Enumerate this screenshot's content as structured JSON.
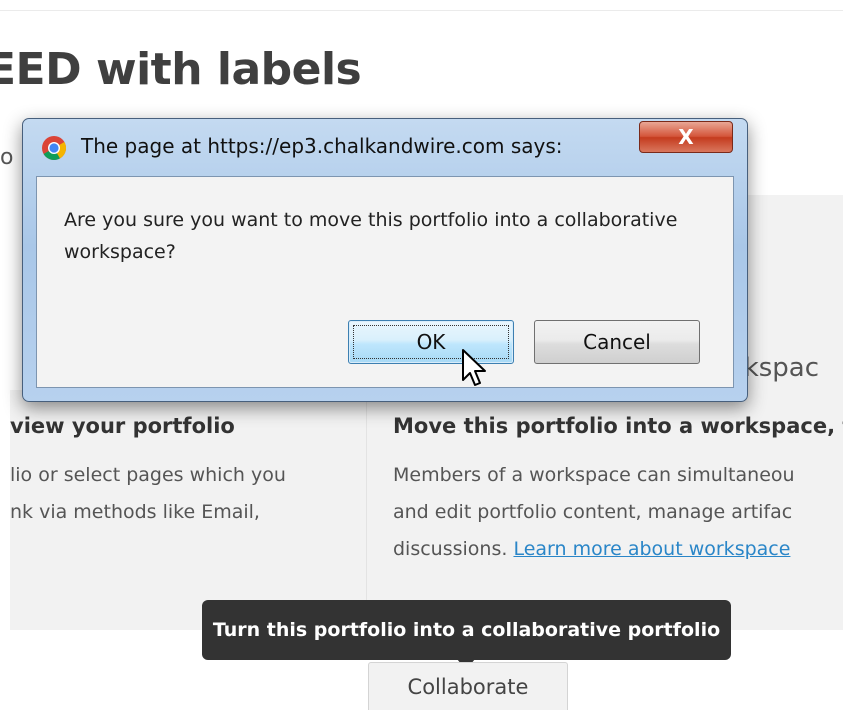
{
  "page": {
    "title": "EED with labels",
    "stray_char": "o"
  },
  "options": {
    "left": {
      "heading": "view your portfolio",
      "line1": "lio or select pages which you",
      "line2": "nk via methods like Email,"
    },
    "right": {
      "peek": "rkspac",
      "heading": "Move this portfolio into a workspace, th",
      "line1": "Members of a workspace can simultaneou",
      "line2": "and edit portfolio content, manage artifac",
      "line3_prefix": "discussions. ",
      "learn_more_link": "Learn more about workspace"
    }
  },
  "tooltip": {
    "text": "Turn this portfolio into a collaborative portfolio"
  },
  "collaborate_button": {
    "label": "Collaborate"
  },
  "dialog": {
    "title": "The page at https://ep3.chalkandwire.com says:",
    "message": "Are you sure you want to move this portfolio into a collaborative workspace?",
    "ok_label": "OK",
    "cancel_label": "Cancel",
    "close_glyph": "X",
    "icon": "chrome-icon"
  },
  "colors": {
    "link": "#2a86c8",
    "tooltip_bg": "#333333",
    "panel_bg": "#f2f2f2",
    "close_button": "#c43b1e"
  }
}
